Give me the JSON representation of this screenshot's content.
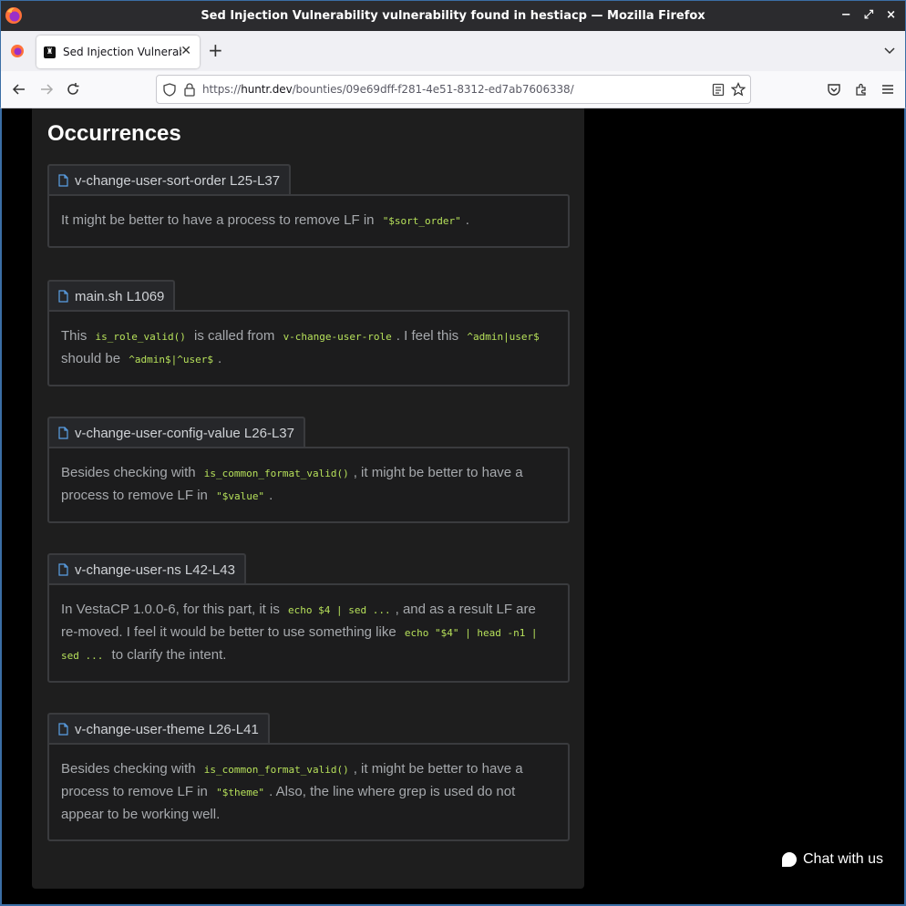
{
  "window": {
    "title": "Sed Injection Vulnerability vulnerability found in hestiacp — Mozilla Firefox",
    "controls": [
      "−",
      "⤢",
      "×"
    ]
  },
  "tabbar": {
    "active_tab_title": "Sed Injection Vulnerability",
    "new_tab_label": "+"
  },
  "navbar": {
    "url_prefix": "https://",
    "url_host": "huntr.dev",
    "url_path": "/bounties/09e69dff-f281-4e51-8312-ed7ab7606338/"
  },
  "page": {
    "heading": "Occurrences",
    "occurrences": [
      {
        "file": "v-change-user-sort-order L25-L37",
        "text": [
          {
            "t": "It might be better to have a process to remove LF in "
          },
          {
            "code": "\"$sort_order\""
          },
          {
            "t": "."
          }
        ]
      },
      {
        "file": "main.sh L1069",
        "text": [
          {
            "t": "This "
          },
          {
            "code": "is_role_valid()"
          },
          {
            "t": " is called from "
          },
          {
            "code": "v-change-user-role"
          },
          {
            "t": ". I feel this "
          },
          {
            "code": "^admin|user$"
          },
          {
            "t": " should be "
          },
          {
            "code": "^admin$|^user$"
          },
          {
            "t": "."
          }
        ]
      },
      {
        "file": "v-change-user-config-value L26-L37",
        "text": [
          {
            "t": "Besides checking with "
          },
          {
            "code": "is_common_format_valid()"
          },
          {
            "t": ", it might be better to have a process to remove LF in "
          },
          {
            "code": "\"$value\""
          },
          {
            "t": "."
          }
        ]
      },
      {
        "file": "v-change-user-ns L42-L43",
        "text": [
          {
            "t": "In VestaCP 1.0.0-6, for this part, it is "
          },
          {
            "code": "echo $4 | sed ..."
          },
          {
            "t": ", and as a result LF are re-moved. I feel it would be better to use something like "
          },
          {
            "code": "echo \"$4\" | head -n1 | sed ..."
          },
          {
            "t": " to clarify the intent."
          }
        ]
      },
      {
        "file": "v-change-user-theme L26-L41",
        "text": [
          {
            "t": "Besides checking with "
          },
          {
            "code": "is_common_format_valid()"
          },
          {
            "t": ", it might be better to have a process to remove LF in "
          },
          {
            "code": "\"$theme\""
          },
          {
            "t": ". Also, the line where grep is used do not appear to be working well."
          }
        ]
      }
    ]
  },
  "chat": {
    "label": "Chat with us"
  },
  "colors": {
    "code": "#b6e05a",
    "icon_blue": "#5aa0e6",
    "panel": "#1e1e1e"
  },
  "icons": [
    "firefox-logo-icon",
    "file-icon",
    "back-icon",
    "forward-icon",
    "reload-icon",
    "shield-icon",
    "lock-icon",
    "reader-icon",
    "star-icon",
    "pocket-icon",
    "extensions-icon",
    "menu-icon",
    "chat-bubble-icon"
  ]
}
